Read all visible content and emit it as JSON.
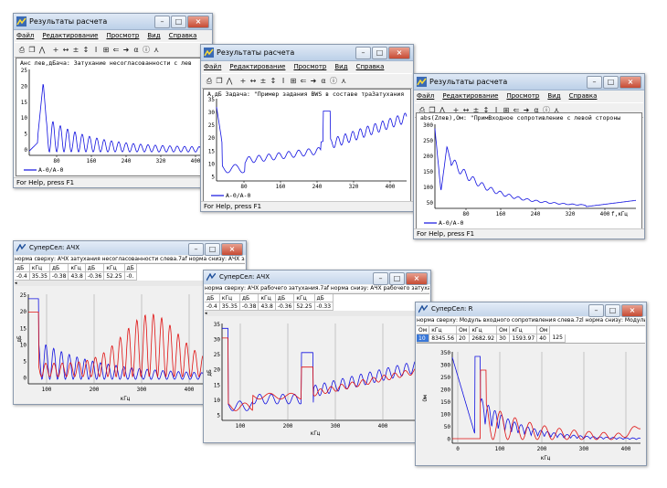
{
  "windows": {
    "w1": {
      "title": "Результаты расчета",
      "menu": [
        "Файл",
        "Редактирование",
        "Просмотр",
        "Вид",
        "Справка"
      ],
      "plot_caption": "Анс лев,дБача: Затухание несогласованности с лев",
      "yticks": [
        "25",
        "20",
        "15",
        "10",
        "5",
        "0"
      ],
      "xticks": [
        "80",
        "160",
        "240",
        "320",
        "400"
      ],
      "legend": "A-0/A-0",
      "status": "For Help, press F1"
    },
    "w2": {
      "title": "Результаты расчета",
      "menu": [
        "Файл",
        "Редактирование",
        "Просмотр",
        "Вид",
        "Справка"
      ],
      "plot_caption": "А,дБ   Задача: \"Пример задания BWS в составе трaЗатухания",
      "yticks": [
        "35",
        "30",
        "25",
        "20",
        "15",
        "10",
        "5"
      ],
      "xticks": [
        "80",
        "160",
        "240",
        "320",
        "400"
      ],
      "legend": "A-0/A-0",
      "status": "For Help, press F1"
    },
    "w3": {
      "title": "Результаты расчета",
      "menu": [
        "Файл",
        "Редактирование",
        "Просмотр",
        "Вид",
        "Справка"
      ],
      "plot_caption": "abs(Zлев),Ом: \"ПримВходное сопротивление с левой стороны",
      "yticks": [
        "300",
        "250",
        "200",
        "150",
        "100",
        "50"
      ],
      "xticks": [
        "80",
        "160",
        "240",
        "320",
        "400"
      ],
      "xlabel": "f,кГц",
      "legend": "A-0/A-0",
      "status": "For Help, press F1"
    },
    "s1": {
      "title": "СуперСел: АЧХ",
      "header": "норма сверху: АЧХ затухания несогласованности слева.7af  норма снизу: АЧХ затухания несог",
      "grid_head": [
        "дБ",
        "кГц",
        "дБ",
        "кГц",
        "дБ",
        "кГц",
        "дБ"
      ],
      "grid_row": [
        "-0.4",
        "35.35",
        "-0.38",
        "43.8",
        "-0.36",
        "52.25",
        "-0."
      ],
      "yticks": [
        "25",
        "20",
        "15",
        "10",
        "5",
        "0"
      ],
      "xticks": [
        "100",
        "200",
        "300",
        "400"
      ],
      "ylabel": "дБ",
      "xlabel": "кГц"
    },
    "s2": {
      "title": "СуперСел: АЧХ",
      "header": "норма сверху: АЧХ рабочего затухания.7af  норма снизу: АЧХ рабочего затухания.7af",
      "grid_head": [
        "дБ",
        "кГц",
        "дБ",
        "кГц",
        "дБ",
        "кГц",
        "дБ"
      ],
      "grid_row": [
        "-0.4",
        "35.35",
        "-0.38",
        "43.8",
        "-0.36",
        "52.25",
        "-0.33"
      ],
      "yticks": [
        "35",
        "30",
        "25",
        "20",
        "15",
        "10",
        "5"
      ],
      "xticks": [
        "100",
        "200",
        "300",
        "400"
      ],
      "ylabel": "дБ",
      "xlabel": "кГц"
    },
    "s3": {
      "title": "СуперСел: R",
      "header": "норма сверху: Модуль входного сопротивления слева.7zl  норма снизу: Модуль входного сопрот",
      "grid_head": [
        "Ом",
        "кГц",
        "Ом",
        "кГц",
        "Ом",
        "кГц",
        "Ом"
      ],
      "grid_row": [
        "10",
        "8345.56",
        "20",
        "2682.92",
        "30",
        "1593.97",
        "40",
        "125"
      ],
      "yticks": [
        "350",
        "300",
        "250",
        "200",
        "150",
        "100",
        "50",
        "0"
      ],
      "xticks": [
        "0",
        "100",
        "200",
        "300",
        "400"
      ],
      "ylabel": "Ом",
      "xlabel": "кГц"
    }
  },
  "colors": {
    "blue": "#1010e0",
    "red": "#e01010"
  }
}
